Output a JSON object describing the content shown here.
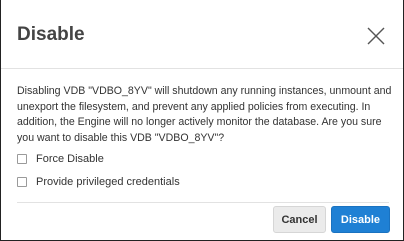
{
  "dialog": {
    "title": "Disable",
    "message": "Disabling VDB \"VDBO_8YV\" will shutdown any running instances, unmount and unexport the filesystem, and prevent any applied policies from executing. In addition, the Engine will no longer actively monitor the database. Are you sure you want to disable this VDB \"VDBO_8YV\"?",
    "options": [
      {
        "label": "Force Disable",
        "checked": false
      },
      {
        "label": "Provide privileged credentials",
        "checked": false
      }
    ],
    "buttons": {
      "cancel_label": "Cancel",
      "confirm_label": "Disable"
    },
    "icons": {
      "close": "close-icon"
    },
    "colors": {
      "primary_button": "#1f80d4",
      "title_text": "#444444",
      "body_text": "#333333"
    }
  }
}
